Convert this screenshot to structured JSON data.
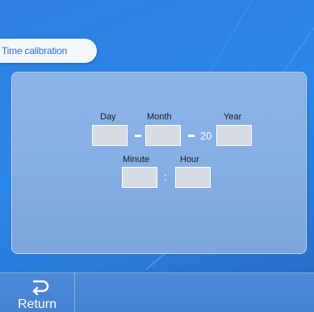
{
  "header": {
    "title": "Time calibration"
  },
  "date": {
    "day_label": "Day",
    "month_label": "Month",
    "year_label": "Year",
    "year_prefix": "20",
    "day_value": "",
    "month_value": "",
    "year_value": ""
  },
  "time": {
    "minute_label": "Minute",
    "hour_label": "Hour",
    "separator": ":",
    "minute_value": "",
    "hour_value": ""
  },
  "footer": {
    "return_label": "Return",
    "return_icon": "return-arrow-icon"
  },
  "colors": {
    "background": "#2a86e8",
    "panel": "#86afe5",
    "field": "#d7dce3",
    "title_text": "#2d6fd0"
  }
}
